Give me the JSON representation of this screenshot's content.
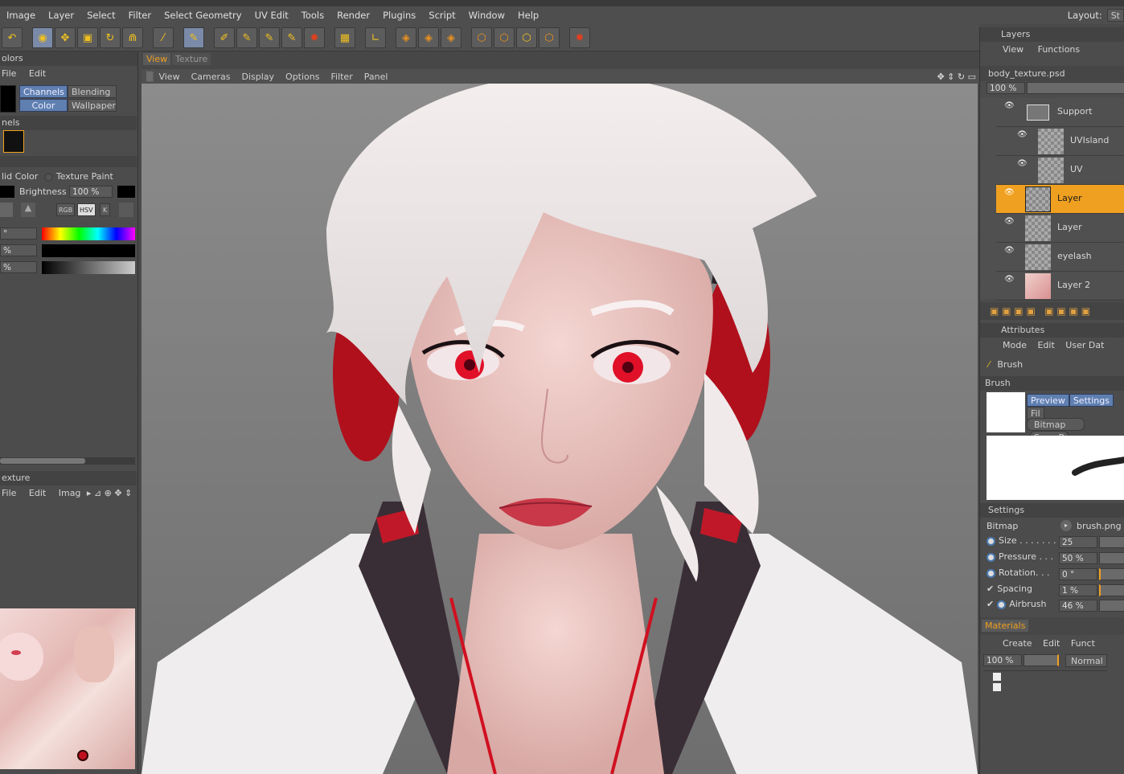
{
  "menu": [
    "Image",
    "Layer",
    "Select",
    "Filter",
    "Select Geometry",
    "UV Edit",
    "Tools",
    "Render",
    "Plugins",
    "Script",
    "Window",
    "Help"
  ],
  "layout_label": "Layout:",
  "layout_value": "St",
  "left": {
    "colors_title": "olors",
    "colors_menu": [
      "File",
      "Edit"
    ],
    "tabs_row1": [
      "Channels",
      "Blending"
    ],
    "tabs_row2": [
      "Color",
      "Wallpaper"
    ],
    "panels_title": "nels",
    "mode_solid": "lid Color",
    "mode_texture": "Texture Paint",
    "brightness_label": "Brightness",
    "brightness_value": "100 %",
    "color_buttons": [
      "RGB",
      "HSV",
      "K"
    ],
    "field1": "°",
    "field2": "%",
    "field3": "%",
    "texture_title": "exture",
    "texture_menu": [
      "File",
      "Edit",
      "Imag"
    ]
  },
  "view": {
    "tabs": [
      "View",
      "Texture"
    ],
    "menu": [
      "View",
      "Cameras",
      "Display",
      "Options",
      "Filter",
      "Panel"
    ]
  },
  "layers": {
    "title": "Layers",
    "menu": [
      "View",
      "Functions"
    ],
    "filename": "body_texture.psd",
    "zoom": "100 %",
    "items": [
      {
        "name": "Support",
        "selected": false
      },
      {
        "name": "UVIsland",
        "selected": false
      },
      {
        "name": "UV",
        "selected": false
      },
      {
        "name": "Layer",
        "selected": true
      },
      {
        "name": "Layer",
        "selected": false
      },
      {
        "name": "eyelash",
        "selected": false
      },
      {
        "name": "Layer 2",
        "selected": false
      }
    ]
  },
  "attributes": {
    "title": "Attributes",
    "menu": [
      "Mode",
      "Edit",
      "User Dat"
    ],
    "brush_label": "Brush",
    "section_brush": "Brush",
    "preview_tabs": [
      "Preview",
      "Settings",
      "Fil"
    ],
    "bitmap_dropdown": "Bitmap",
    "save_button": "Save B",
    "settings_title": "Settings",
    "bitmap_label": "Bitmap",
    "bitmap_file": "brush.png",
    "size_label": "Size . . . . . . .",
    "size_value": "25",
    "pressure_label": "Pressure . . .",
    "pressure_value": "50 %",
    "rotation_label": "Rotation. . .",
    "rotation_value": "0 °",
    "spacing_label": "Spacing",
    "spacing_value": "1 %",
    "airbrush_label": "Airbrush",
    "airbrush_value": "46 %"
  },
  "materials": {
    "title": "Materials",
    "menu": [
      "Create",
      "Edit",
      "Funct"
    ],
    "zoom": "100 %",
    "blend": "Normal"
  },
  "colors": {
    "accent": "#f0a020",
    "tab_blue": "#5f7fb0"
  }
}
